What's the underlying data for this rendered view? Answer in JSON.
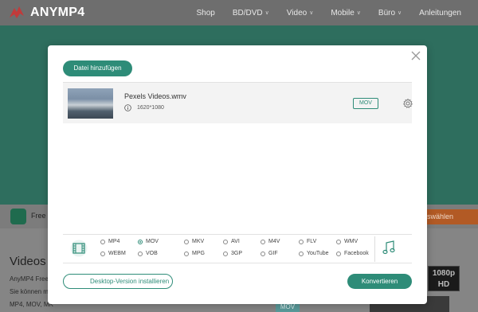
{
  "header": {
    "brand": "ANYMP4",
    "nav": [
      {
        "label": "Shop",
        "has_dropdown": false
      },
      {
        "label": "BD/DVD",
        "has_dropdown": true
      },
      {
        "label": "Video",
        "has_dropdown": true
      },
      {
        "label": "Mobile",
        "has_dropdown": true
      },
      {
        "label": "Büro",
        "has_dropdown": true
      },
      {
        "label": "Anleitungen",
        "has_dropdown": false
      }
    ]
  },
  "background": {
    "strip_text": "Free C",
    "strip_button": "auswählen",
    "section_title": "Videos k",
    "para1": "AnyMP4 Free C",
    "para2": "Sie können me",
    "para3": "MP4, MOV, MK",
    "badge_hd": "1080p HD",
    "badge_mov": "MOV"
  },
  "modal": {
    "add_file_label": "Datei hinzufügen",
    "file": {
      "name": "Pexels Videos.wmv",
      "resolution": "1620*1080",
      "format": "MOV"
    },
    "formats_row1": [
      "MP4",
      "MOV",
      "MKV",
      "AVI",
      "M4V",
      "FLV",
      "WMV"
    ],
    "formats_row2": [
      "WEBM",
      "VOB",
      "MPG",
      "3GP",
      "GIF",
      "YouTube",
      "Facebook"
    ],
    "selected_format": "MOV",
    "desktop_button": "Desktop-Version installieren",
    "convert_button": "Konvertieren"
  },
  "colors": {
    "accent": "#2e8c78",
    "hero_dim": "#2e6e5e",
    "overlay_gray": "#8a8a8a"
  }
}
